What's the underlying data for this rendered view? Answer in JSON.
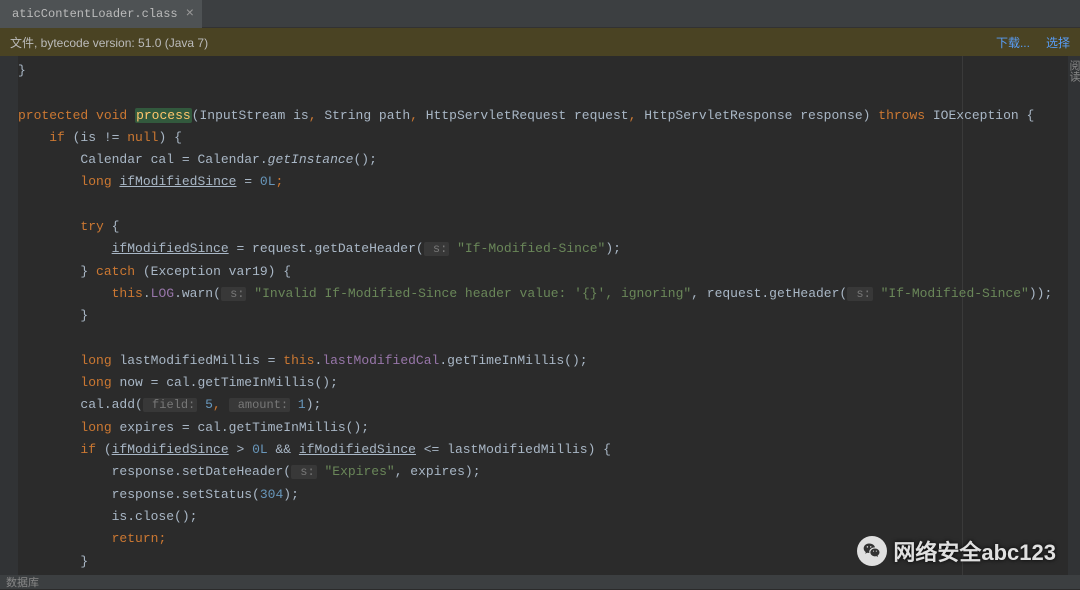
{
  "tab": {
    "name": "aticContentLoader.class",
    "close": "×"
  },
  "info": {
    "msg": "文件, bytecode version: 51.0 (Java 7)",
    "download": "下载...",
    "select": "选择"
  },
  "sidebar_right_label": "阅读",
  "status": "数据库",
  "watermark": "网络安全abc123",
  "code": {
    "l1": "}",
    "kw_protected": "protected",
    "kw_void": "void",
    "m_process": "process",
    "sig_open": "(InputStream is",
    "c": ",",
    "sig2": " String path",
    "sig3": " HttpServletRequest request",
    "sig4": " HttpServletResponse response)",
    "kw_throws": "throws",
    "sig5": " IOException {",
    "kw_if": "if",
    "cond1": " (is != ",
    "kw_null": "null",
    "cond1b": ") {",
    "l4a": "Calendar cal = Calendar.",
    "m_getInst": "getInstance",
    "l4b": "();",
    "kw_long": "long",
    "l5a": " ",
    "v_ifms": "ifModifiedSince",
    "l5b": " = ",
    "n0": "0L",
    "semi": ";",
    "kw_try": "try",
    "brace_o": " {",
    "l7a": " = request.getDateHeader(",
    "h_s": " s:",
    "s_ifms": "\"If-Modified-Since\"",
    "l7b": ");",
    "brace_c": "}",
    "kw_catch": "catch",
    "l8a": " (Exception var19) {",
    "kw_this": "this",
    "l9a": ".",
    "f_log": "LOG",
    "l9b": ".warn(",
    "s_inv": "\"Invalid If-Modified-Since header value: '{}', ignoring\"",
    "l9c": ", request.getHeader(",
    "l9d": "));",
    "l11a": " lastModifiedMillis = ",
    "l11b": ".",
    "f_lmc": "lastModifiedCal",
    "l11c": ".getTimeInMillis();",
    "l12a": " now = cal.getTimeInMillis();",
    "l13a": "cal.add(",
    "h_field": " field:",
    "n5": "5",
    "l13b": ", ",
    "h_amount": " amount:",
    "n1": "1",
    "l13c": ");",
    "l14a": " expires = cal.getTimeInMillis();",
    "l15a": " (",
    "l15b": " > ",
    "l15c": " && ",
    "l15d": " <= lastModifiedMillis) {",
    "l16a": "response.setDateHeader(",
    "s_exp": "\"Expires\"",
    "l16b": ", expires);",
    "l17a": "response.setStatus(",
    "n304": "304",
    "l17b": ");",
    "l18": "is.close();",
    "kw_return": "return",
    "brace_c2": "}"
  }
}
